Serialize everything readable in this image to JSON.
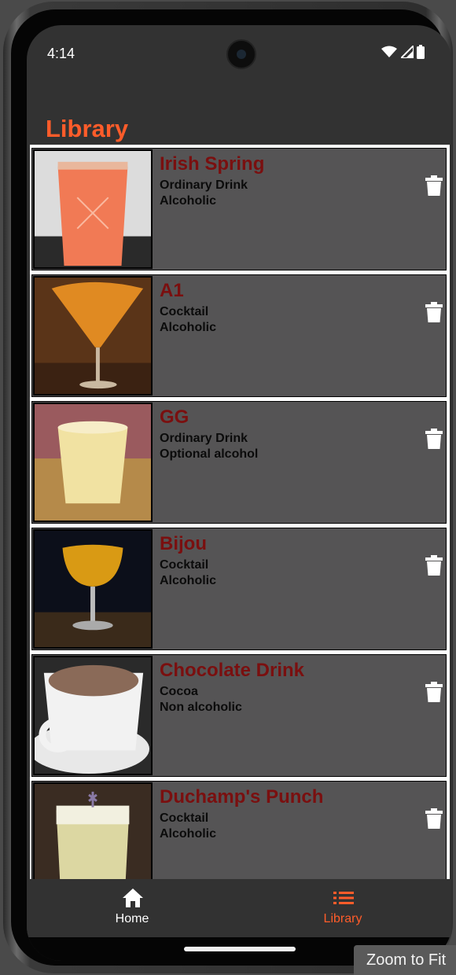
{
  "status_bar": {
    "time": "4:14"
  },
  "app_bar": {
    "title": "Library"
  },
  "drinks": [
    {
      "name": "Irish Spring",
      "category": "Ordinary Drink",
      "alcoholic": "Alcoholic"
    },
    {
      "name": "A1",
      "category": "Cocktail",
      "alcoholic": "Alcoholic"
    },
    {
      "name": "GG",
      "category": "Ordinary Drink",
      "alcoholic": "Optional alcohol"
    },
    {
      "name": "Bijou",
      "category": "Cocktail",
      "alcoholic": "Alcoholic"
    },
    {
      "name": "Chocolate Drink",
      "category": "Cocoa",
      "alcoholic": "Non alcoholic"
    },
    {
      "name": "Duchamp's Punch",
      "category": "Cocktail",
      "alcoholic": "Alcoholic"
    }
  ],
  "bottom_nav": {
    "home_label": "Home",
    "library_label": "Library",
    "active": "Library"
  },
  "overlay": {
    "zoom_label": "Zoom to Fit"
  },
  "colors": {
    "accent": "#ff5c2a",
    "drink_name": "#7a0f0f",
    "card_bg": "#555455",
    "screen_bg": "#323232"
  },
  "icons": {
    "wifi": "wifi-icon",
    "signal": "signal-icon",
    "battery": "battery-icon",
    "delete": "trash-icon",
    "home": "home-icon",
    "library": "list-icon"
  }
}
